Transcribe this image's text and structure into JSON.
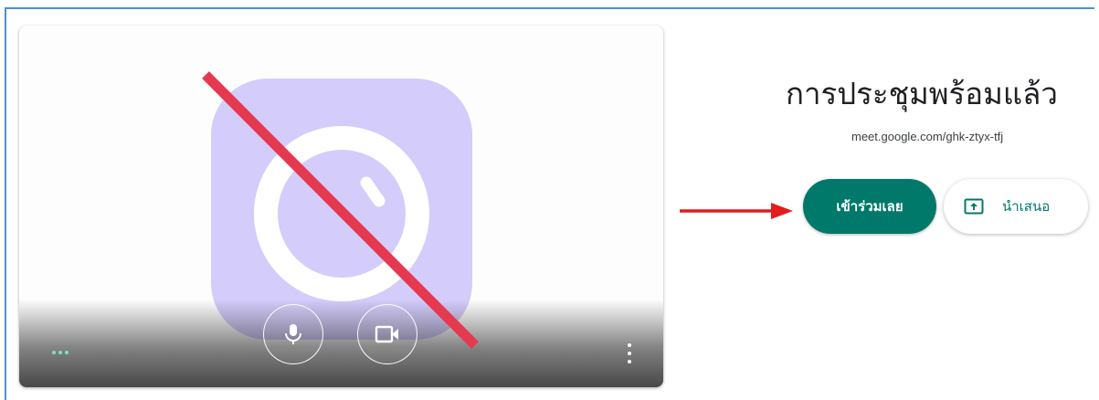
{
  "meeting": {
    "title": "การประชุมพร้อมแล้ว",
    "link": "meet.google.com/ghk-ztyx-tfj"
  },
  "actions": {
    "join_label": "เข้าร่วมเลย",
    "present_label": "นำเสนอ"
  },
  "preview": {
    "camera_state": "off",
    "mic_icon": "microphone-icon",
    "camera_icon": "video-camera-icon",
    "more_icon": "more-vert-icon",
    "activity_icon": "audio-activity-dots-icon"
  },
  "annotations": {
    "arrow_color": "#e11d1d",
    "slash_color": "#e53950"
  },
  "colors": {
    "accent": "#00796b",
    "camera_placeholder": "#d4ccfb",
    "text_primary": "#202124"
  }
}
